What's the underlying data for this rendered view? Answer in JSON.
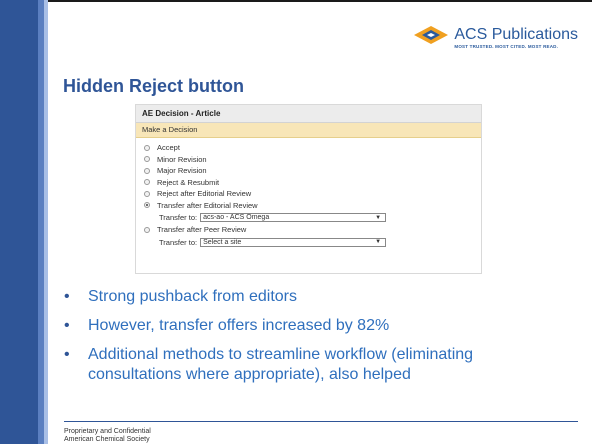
{
  "logo": {
    "name": "ACS Publications",
    "tagline": "MOST TRUSTED. MOST CITED. MOST READ."
  },
  "slide": {
    "title": "Hidden Reject button"
  },
  "dialog": {
    "header": "AE Decision - Article",
    "subheader": "Make a Decision",
    "options": [
      "Accept",
      "Minor Revision",
      "Major Revision",
      "Reject & Resubmit",
      "Reject after Editorial Review",
      "Transfer after Editorial Review"
    ],
    "selected_option": "Transfer after Editorial Review",
    "transfer1": {
      "label": "Transfer to:",
      "value": "acs-ao - ACS Omega"
    },
    "peer_option": "Transfer after Peer Review",
    "transfer2": {
      "label": "Transfer to:",
      "value": "Select a site"
    }
  },
  "bullets": [
    "Strong pushback from editors",
    "However, transfer offers increased by 82%",
    "Additional methods to streamline workflow (eliminating consultations where appropriate), also helped"
  ],
  "footer": {
    "line1": "Proprietary and Confidential",
    "line2": "American Chemical Society"
  },
  "colors": {
    "accent": "#2f5597",
    "bullet_text": "#2f6fbd",
    "banner": "#f8e6b8"
  }
}
